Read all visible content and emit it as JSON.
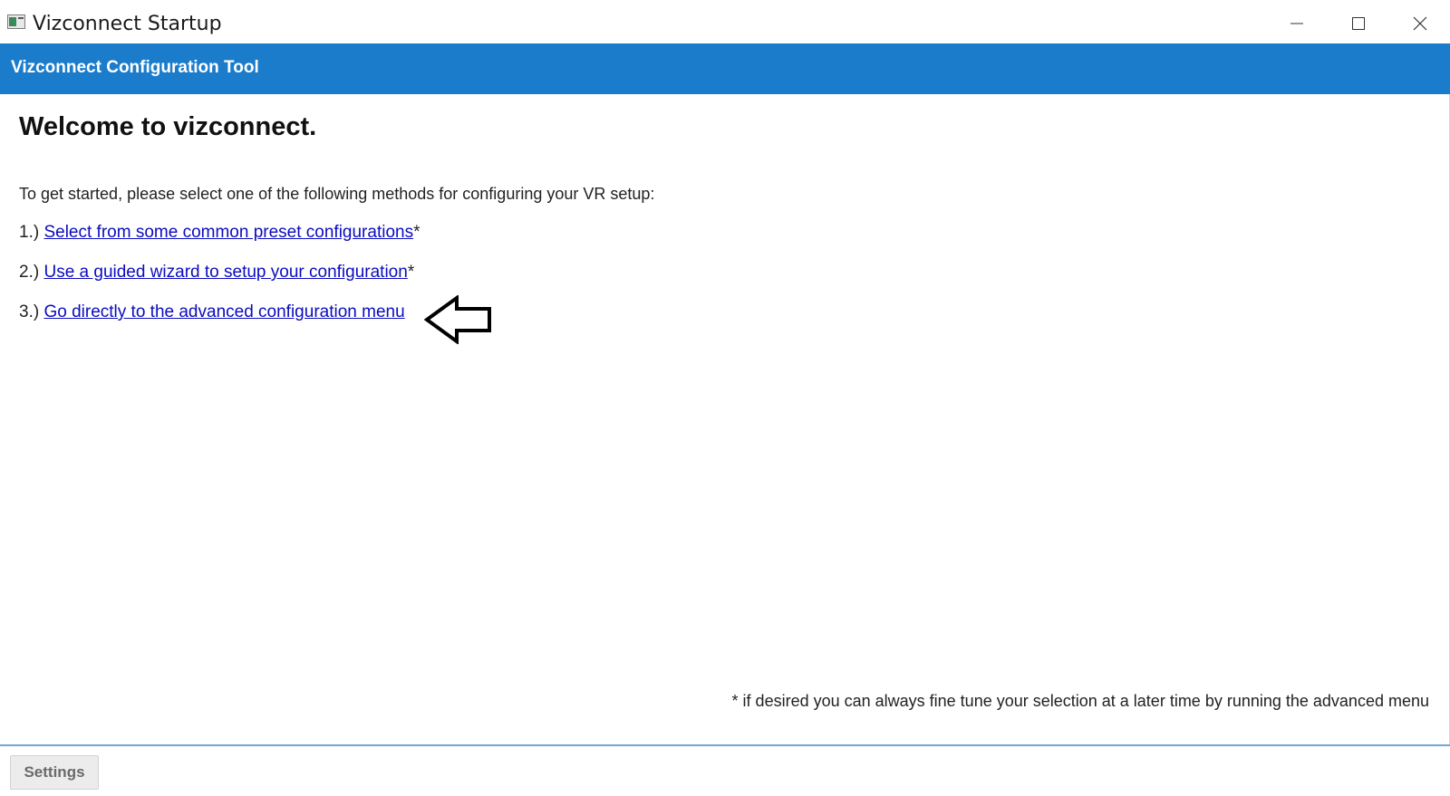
{
  "window": {
    "title": "Vizconnect Startup",
    "app_icon": "app-window-icon",
    "controls": {
      "minimize_icon": "minimize-icon",
      "maximize_icon": "maximize-icon",
      "close_icon": "close-icon"
    }
  },
  "header": {
    "title": "Vizconnect Configuration Tool",
    "color": "#1b7ccc"
  },
  "main": {
    "welcome": "Welcome to vizconnect.",
    "intro": "To get started, please select one of the following methods for configuring your VR setup:",
    "options": [
      {
        "number": "1.)",
        "link": "Select from some common preset configurations",
        "suffix": "*"
      },
      {
        "number": "2.)",
        "link": "Use a guided wizard to setup your configuration",
        "suffix": "*"
      },
      {
        "number": "3.)",
        "link": "Go directly to the advanced configuration menu",
        "suffix": ""
      }
    ],
    "annotation_icon": "left-arrow-icon",
    "footnote": "* if desired you can always fine tune your selection at a later time by running the advanced menu"
  },
  "footer": {
    "settings_label": "Settings"
  },
  "colors": {
    "link": "#0b0bc0",
    "accent": "#1b7ccc"
  }
}
